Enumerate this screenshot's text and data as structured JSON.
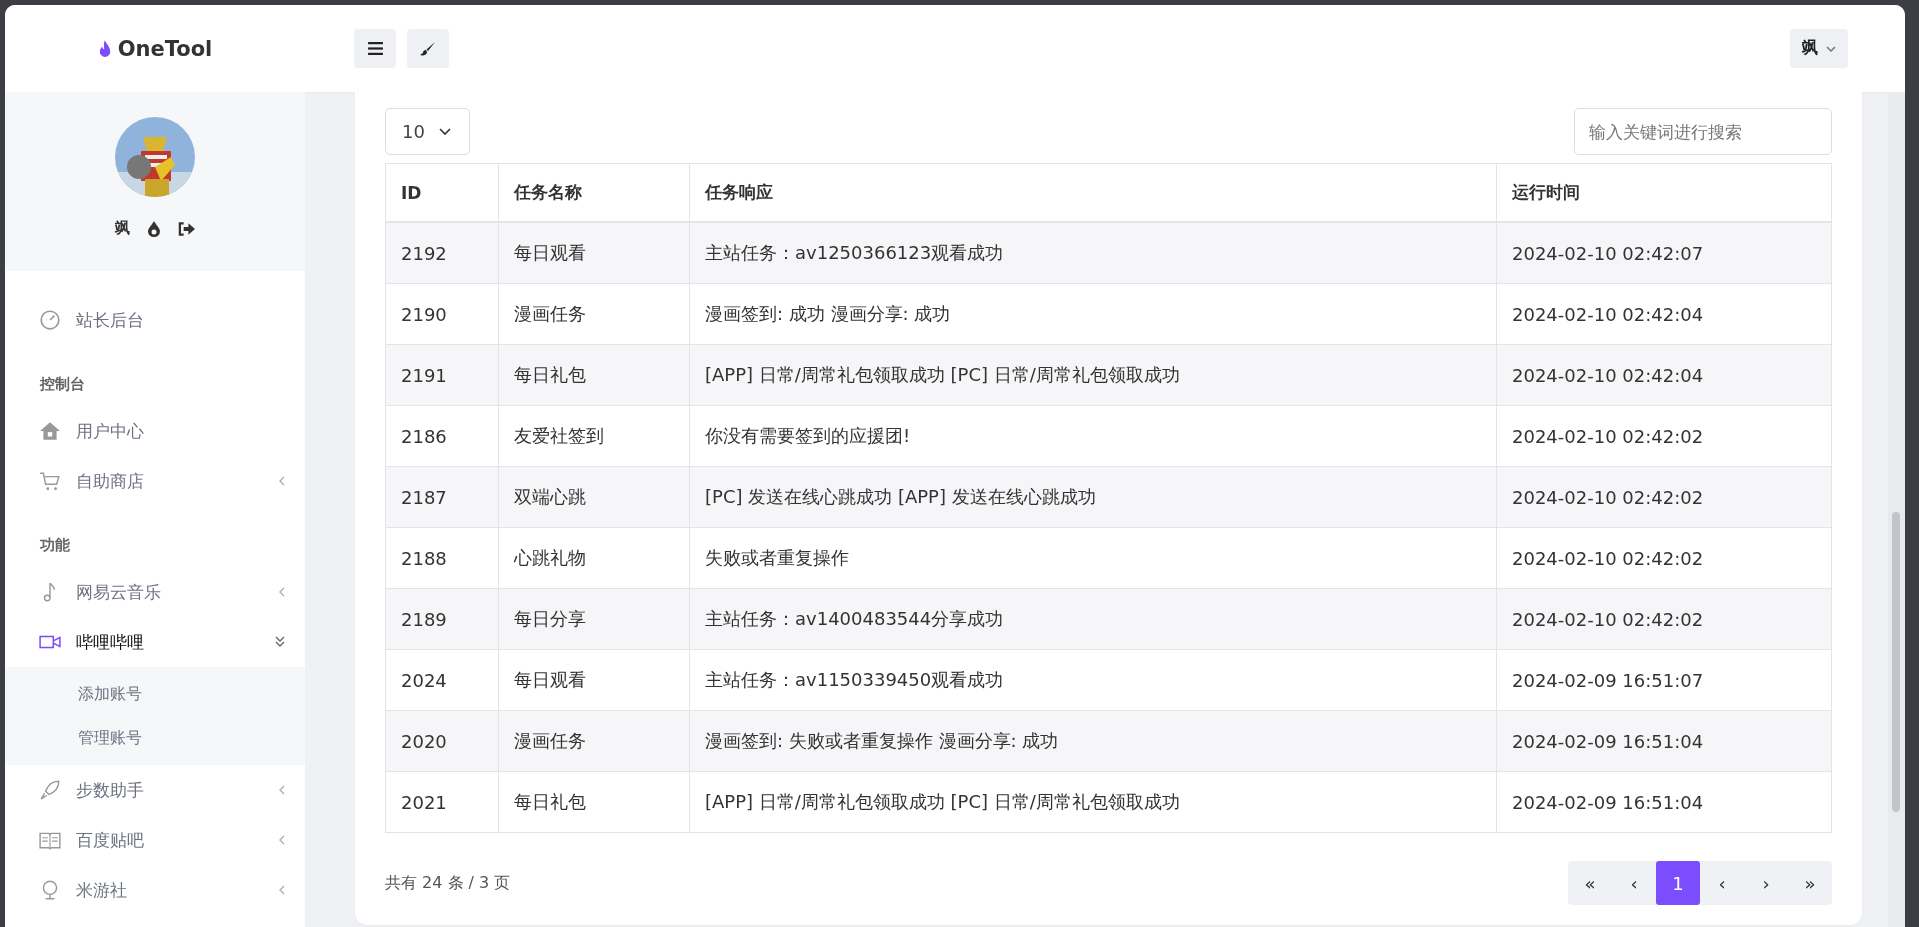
{
  "brand": {
    "name": "OneTool"
  },
  "header": {
    "user": "飒"
  },
  "profile": {
    "name": "飒"
  },
  "sidebar": [
    {
      "kind": "link",
      "label": "站长后台",
      "selected": false
    },
    {
      "kind": "heading",
      "label": "控制台"
    },
    {
      "kind": "link",
      "label": "用户中心",
      "selected": false
    },
    {
      "kind": "link",
      "label": "自助商店",
      "selected": false,
      "expanded": false
    },
    {
      "kind": "heading",
      "label": "功能"
    },
    {
      "kind": "link",
      "label": "网易云音乐",
      "selected": false,
      "expanded": false
    },
    {
      "kind": "link",
      "label": "哔哩哔哩",
      "selected": true,
      "expanded": true,
      "children": [
        {
          "label": "添加账号",
          "selected": false
        },
        {
          "label": "管理账号",
          "selected": false
        }
      ]
    },
    {
      "kind": "link",
      "label": "步数助手",
      "selected": false,
      "expanded": false
    },
    {
      "kind": "link",
      "label": "百度贴吧",
      "selected": false,
      "expanded": false
    },
    {
      "kind": "link",
      "label": "米游社",
      "selected": false,
      "expanded": false
    }
  ],
  "page_size": "10",
  "search": {
    "placeholder": "输入关键词进行搜索"
  },
  "table": {
    "columns": [
      "ID",
      "任务名称",
      "任务响应",
      "运行时间"
    ],
    "rows": [
      [
        "2192",
        "每日观看",
        "主站任务：av1250366123观看成功",
        "2024-02-10 02:42:07"
      ],
      [
        "2190",
        "漫画任务",
        "漫画签到: 成功 漫画分享: 成功",
        "2024-02-10 02:42:04"
      ],
      [
        "2191",
        "每日礼包",
        "[APP] 日常/周常礼包领取成功 [PC] 日常/周常礼包领取成功",
        "2024-02-10 02:42:04"
      ],
      [
        "2186",
        "友爱社签到",
        "你没有需要签到的应援团!",
        "2024-02-10 02:42:02"
      ],
      [
        "2187",
        "双端心跳",
        "[PC] 发送在线心跳成功 [APP] 发送在线心跳成功",
        "2024-02-10 02:42:02"
      ],
      [
        "2188",
        "心跳礼物",
        "失败或者重复操作",
        "2024-02-10 02:42:02"
      ],
      [
        "2189",
        "每日分享",
        "主站任务：av1400483544分享成功",
        "2024-02-10 02:42:02"
      ],
      [
        "2024",
        "每日观看",
        "主站任务：av1150339450观看成功",
        "2024-02-09 16:51:07"
      ],
      [
        "2020",
        "漫画任务",
        "漫画签到: 失败或者重复操作 漫画分享: 成功",
        "2024-02-09 16:51:04"
      ],
      [
        "2021",
        "每日礼包",
        "[APP] 日常/周常礼包领取成功 [PC] 日常/周常礼包领取成功",
        "2024-02-09 16:51:04"
      ]
    ]
  },
  "summary": "共有 24 条 / 3 页",
  "pagination": [
    {
      "label": "«",
      "selected": false
    },
    {
      "label": "‹",
      "selected": false
    },
    {
      "label": "1",
      "selected": true
    },
    {
      "label": "‹",
      "selected": false
    },
    {
      "label": "›",
      "selected": false
    },
    {
      "label": "»",
      "selected": false
    }
  ]
}
